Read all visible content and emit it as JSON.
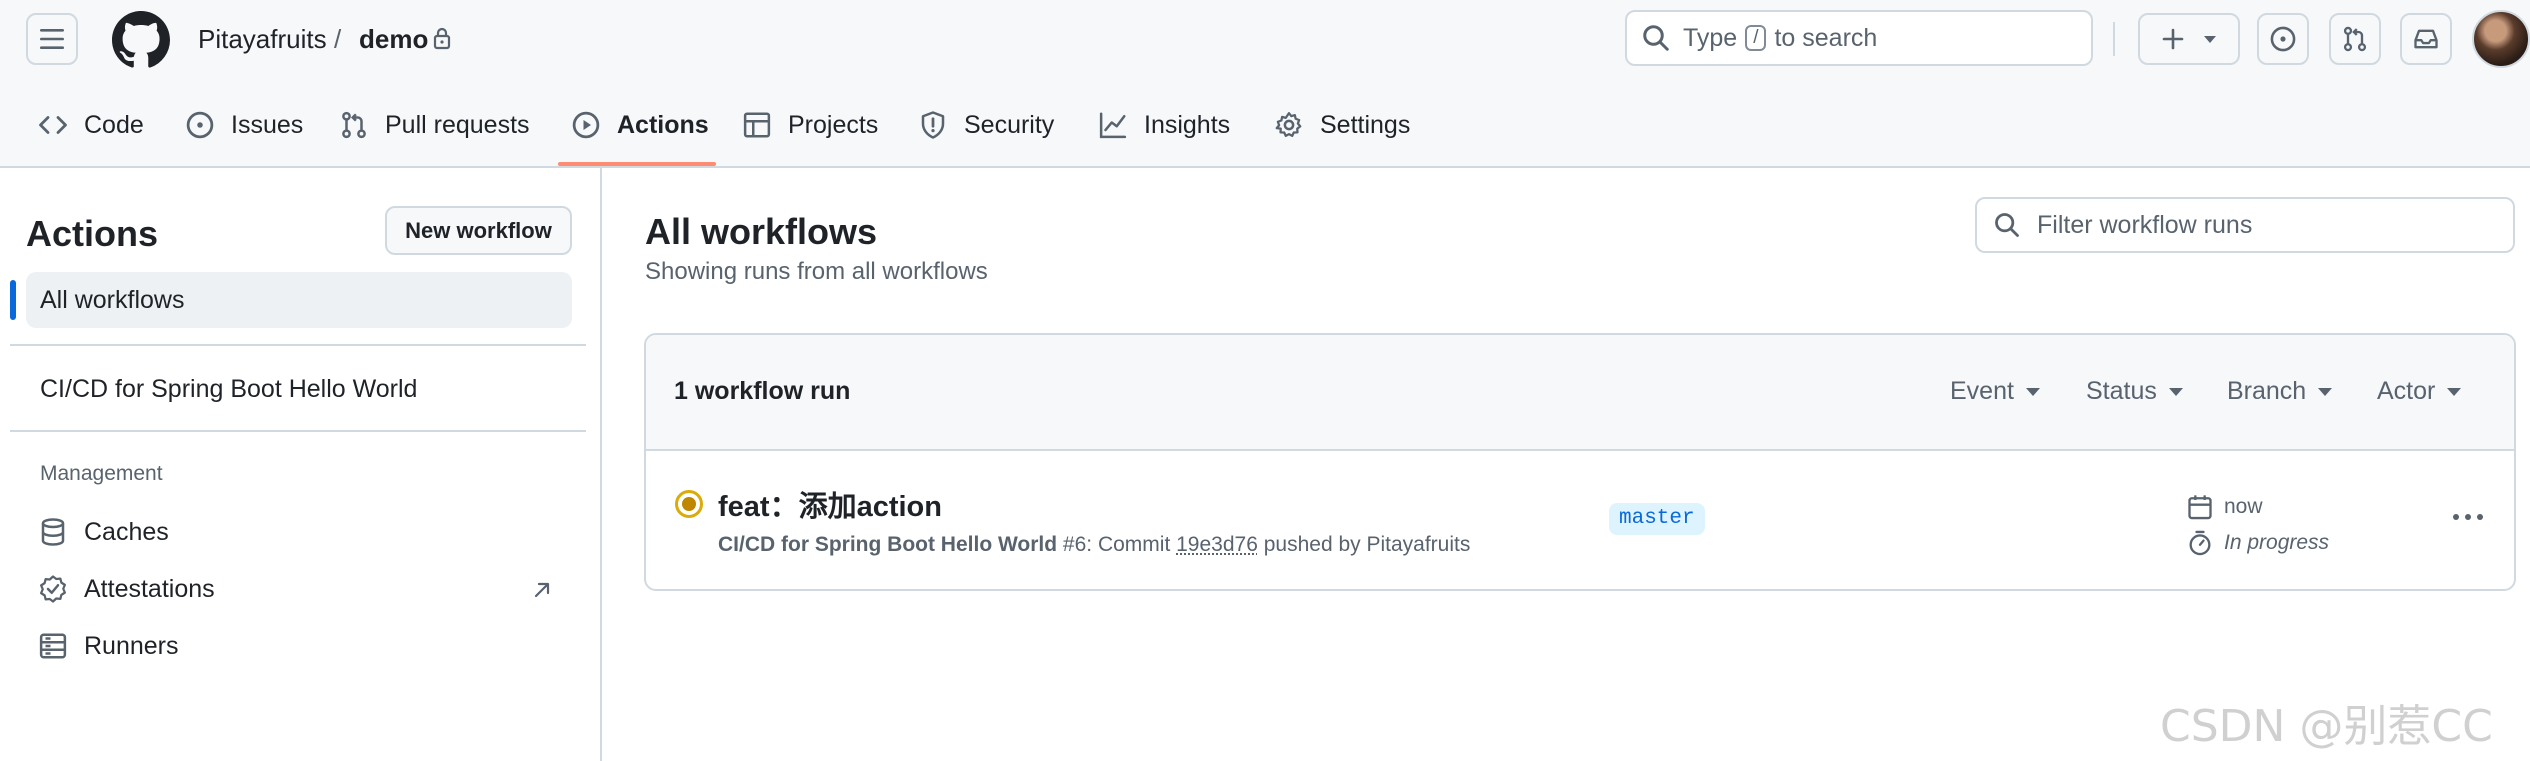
{
  "header": {
    "owner": "Pitayafruits",
    "separator": "/",
    "repo": "demo",
    "search_prefix": "Type",
    "search_key": "/",
    "search_suffix": "to search"
  },
  "nav": {
    "tabs": [
      {
        "label": "Code",
        "icon": "code-icon"
      },
      {
        "label": "Issues",
        "icon": "issue-opened-icon"
      },
      {
        "label": "Pull requests",
        "icon": "git-pull-request-icon"
      },
      {
        "label": "Actions",
        "icon": "play-icon",
        "active": true
      },
      {
        "label": "Projects",
        "icon": "table-icon"
      },
      {
        "label": "Security",
        "icon": "shield-icon"
      },
      {
        "label": "Insights",
        "icon": "graph-icon"
      },
      {
        "label": "Settings",
        "icon": "gear-icon"
      }
    ]
  },
  "sidebar": {
    "title": "Actions",
    "new_workflow": "New workflow",
    "all_workflows": "All workflows",
    "workflows": [
      "CI/CD for Spring Boot Hello World"
    ],
    "management_label": "Management",
    "management": [
      {
        "label": "Caches",
        "icon": "database-icon"
      },
      {
        "label": "Attestations",
        "icon": "verified-icon"
      },
      {
        "label": "Runners",
        "icon": "server-icon"
      }
    ]
  },
  "main": {
    "title": "All workflows",
    "subtitle": "Showing runs from all workflows",
    "filter_placeholder": "Filter workflow runs",
    "run_count": "1 workflow run",
    "filters": [
      "Event",
      "Status",
      "Branch",
      "Actor"
    ],
    "run": {
      "title": "feat：添加action",
      "workflow": "CI/CD for Spring Boot Hello World",
      "meta_number": " #6: Commit ",
      "sha": "19e3d76",
      "pushed_by": " pushed by Pitayafruits",
      "branch": "master",
      "time": "now",
      "status": "In progress"
    }
  },
  "colors": {
    "accent_underline": "#fd8c73",
    "active_bar": "#0969da",
    "in_progress": "#bf8700",
    "branch_bg": "#ddf4ff"
  },
  "watermark": "CSDN @别惹CC"
}
